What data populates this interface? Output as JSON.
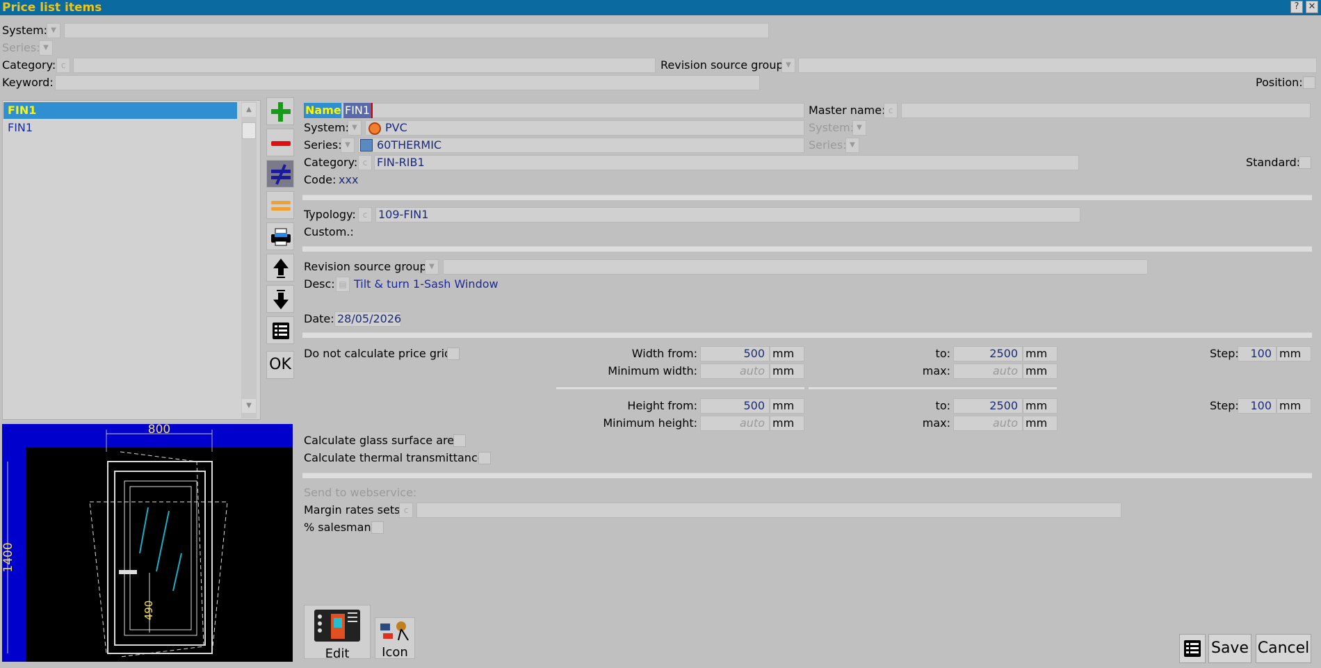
{
  "title": "Price list items",
  "filters": {
    "system_label": "System:",
    "series_label": "Series:",
    "category_label": "Category:",
    "revision_label": "Revision source group:",
    "keyword_label": "Keyword:",
    "position_label": "Position:"
  },
  "list": {
    "items": [
      "FIN1",
      "FIN1"
    ]
  },
  "toolbar": {
    "ok_label": "OK"
  },
  "form": {
    "name_label": "Name:",
    "name_value": "FIN1",
    "master_label": "Master name:",
    "system_label": "System:",
    "system_value": "PVC",
    "system2_label": "System:",
    "series_label": "Series:",
    "series_value": "60THERMIC",
    "series2_label": "Series:",
    "category_label": "Category:",
    "category_value": "FIN-RIB1",
    "standard_label": "Standard:",
    "code_label": "Code:",
    "code_value": "xxx",
    "typology_label": "Typology:",
    "typology_value": "109-FIN1",
    "custom_label": "Custom.:",
    "revision_label": "Revision source group:",
    "desc_label": "Desc:",
    "desc_value": "Tilt & turn 1-Sash Window",
    "date_label": "Date:",
    "date_value": "28/05/2026",
    "no_calc_label": "Do not calculate price grid:",
    "width_from_label": "Width from:",
    "width_from": "500",
    "to_label": "to:",
    "width_to": "2500",
    "step_label": "Step:",
    "width_step": "100",
    "min_width_label": "Minimum width:",
    "max_label": "max:",
    "auto": "auto",
    "unit": "mm",
    "height_from_label": "Height from:",
    "height_from": "500",
    "height_to": "2500",
    "height_step": "100",
    "min_height_label": "Minimum height:",
    "glass_label": "Calculate glass surface area:",
    "thermal_label": "Calculate thermal transmittance:",
    "webservice_label": "Send to webservice:",
    "margin_label": "Margin rates sets:",
    "salesman_label": "% salesman:"
  },
  "preview": {
    "width_dim": "800",
    "height_dim": "1400",
    "handle_dim": "490"
  },
  "buttons": {
    "edit": "Edit",
    "icon": "Icon",
    "save": "Save",
    "cancel": "Cancel"
  },
  "colors": {
    "title_bar": "#0b6aa0",
    "title_text": "#f1c40f",
    "selection": "#2f8fd0",
    "value_text": "#1a2a7a",
    "preview_frame": "#0000cc"
  }
}
